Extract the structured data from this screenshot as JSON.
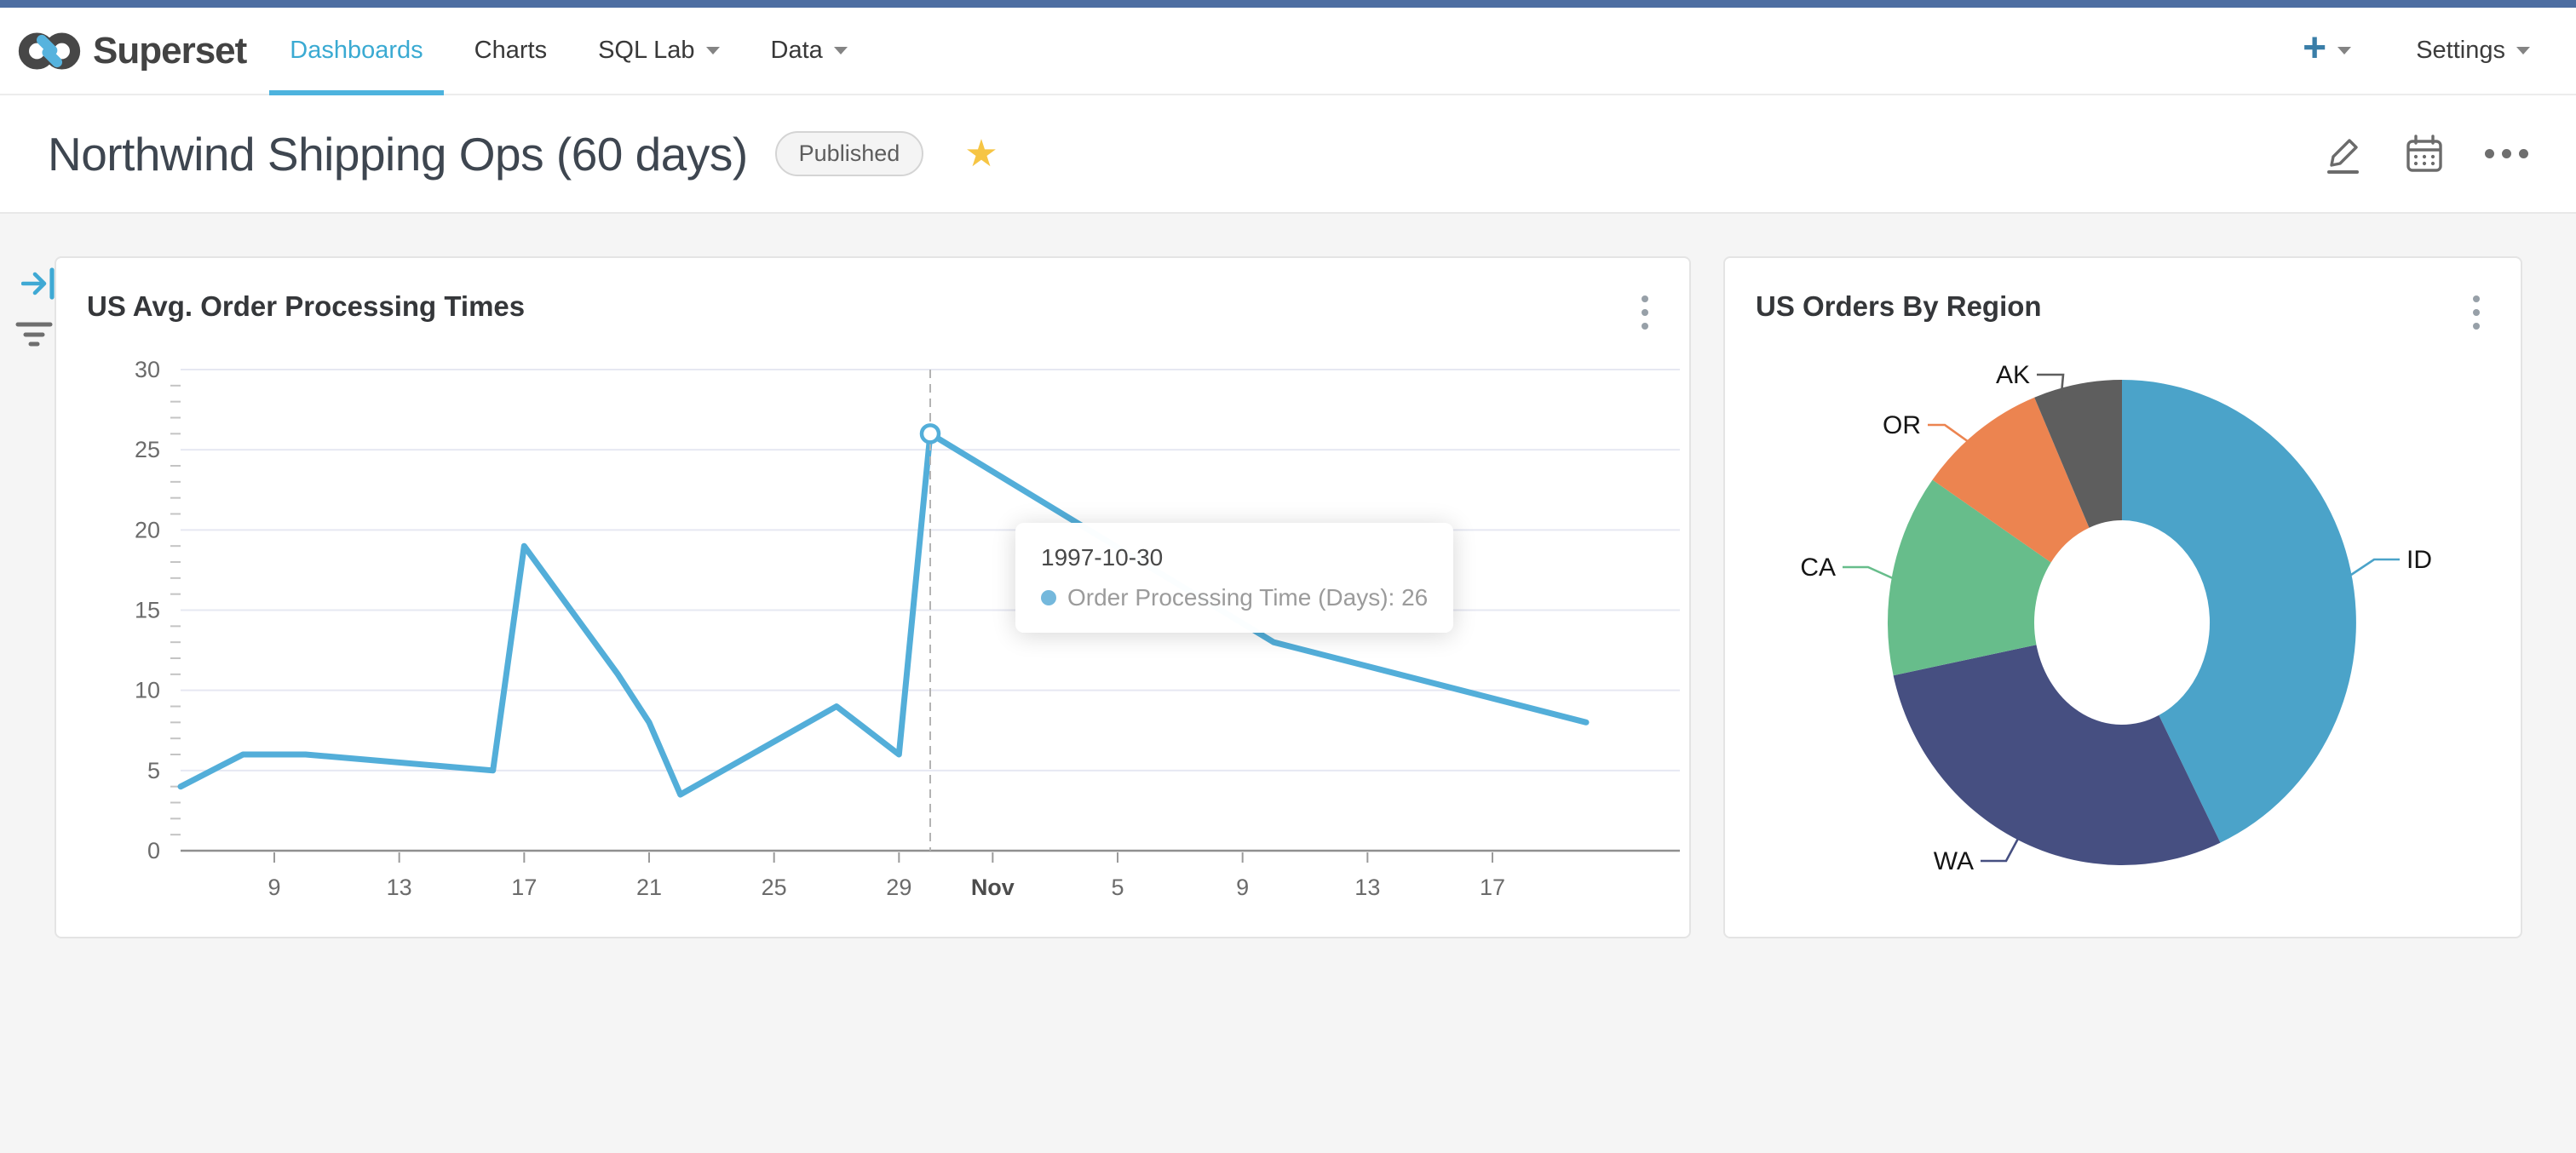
{
  "app": {
    "brand": "Superset"
  },
  "nav": {
    "items": [
      {
        "label": "Dashboards",
        "active": true,
        "caret": false
      },
      {
        "label": "Charts",
        "active": false,
        "caret": false
      },
      {
        "label": "SQL Lab",
        "active": false,
        "caret": true
      },
      {
        "label": "Data",
        "active": false,
        "caret": true
      }
    ],
    "create_label": "+",
    "settings_label": "Settings"
  },
  "header": {
    "title": "Northwind Shipping Ops (60 days)",
    "status_badge": "Published",
    "action_icons": [
      "edit-pencil-icon",
      "calendar-icon",
      "more-horizontal-icon"
    ]
  },
  "filter_rail": {
    "icons": [
      "expand-filter-bar-icon",
      "filter-icon"
    ]
  },
  "colors": {
    "nav_active": "#3aaad2",
    "line_series": "#53aed9",
    "star": "#f6c544",
    "topstrip": "#4e6ea2"
  },
  "chart_data": [
    {
      "type": "line",
      "title": "US Avg. Order Processing Times",
      "xlabel": "",
      "ylabel": "",
      "ylim": [
        0,
        30
      ],
      "y_ticks": [
        0,
        5,
        10,
        15,
        20,
        25,
        30
      ],
      "y_minor_step": 1,
      "grid": true,
      "x_range": [
        "1997-10-06",
        "1997-11-23"
      ],
      "x_ticks": [
        {
          "label": "9",
          "date": "1997-10-09",
          "bold": false
        },
        {
          "label": "13",
          "date": "1997-10-13",
          "bold": false
        },
        {
          "label": "17",
          "date": "1997-10-17",
          "bold": false
        },
        {
          "label": "21",
          "date": "1997-10-21",
          "bold": false
        },
        {
          "label": "25",
          "date": "1997-10-25",
          "bold": false
        },
        {
          "label": "29",
          "date": "1997-10-29",
          "bold": false
        },
        {
          "label": "Nov",
          "date": "1997-11-01",
          "bold": true
        },
        {
          "label": "5",
          "date": "1997-11-05",
          "bold": false
        },
        {
          "label": "9",
          "date": "1997-11-09",
          "bold": false
        },
        {
          "label": "13",
          "date": "1997-11-13",
          "bold": false
        },
        {
          "label": "17",
          "date": "1997-11-17",
          "bold": false
        }
      ],
      "series": [
        {
          "name": "Order Processing Time (Days)",
          "color": "#53aed9",
          "points": [
            [
              "1997-10-06",
              4
            ],
            [
              "1997-10-08",
              6
            ],
            [
              "1997-10-10",
              6
            ],
            [
              "1997-10-16",
              5
            ],
            [
              "1997-10-17",
              19
            ],
            [
              "1997-10-20",
              11
            ],
            [
              "1997-10-21",
              8
            ],
            [
              "1997-10-22",
              3.5
            ],
            [
              "1997-10-27",
              9
            ],
            [
              "1997-10-29",
              6
            ],
            [
              "1997-10-30",
              26
            ],
            [
              "1997-11-10",
              13
            ],
            [
              "1997-11-20",
              8
            ]
          ]
        }
      ],
      "highlight": {
        "date": "1997-10-30",
        "value": 26
      },
      "tooltip": {
        "date": "1997-10-30",
        "series": "Order Processing Time (Days)",
        "value": 26,
        "text": "Order Processing Time (Days): 26"
      }
    },
    {
      "type": "pie",
      "donut": true,
      "title": "US Orders By Region",
      "legend_position": "outside-labels",
      "labels": [
        "ID",
        "WA",
        "CA",
        "OR",
        "AK"
      ],
      "values_pct": [
        43.1,
        28.4,
        13.5,
        8.9,
        6.1
      ],
      "colors": [
        "#4ba3c9",
        "#464f81",
        "#67bd8b",
        "#ec8450",
        "#5e5e5e"
      ]
    }
  ]
}
